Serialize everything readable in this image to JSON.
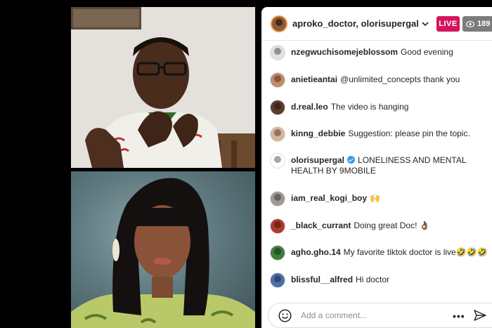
{
  "header": {
    "hosts": "aproko_doctor, olorisupergal",
    "live_label": "LIVE",
    "viewer_count": "189"
  },
  "comments": [
    {
      "user": "nzegwuchisomejeblossom",
      "text": "Good evening",
      "avatar_color": "#e0e0e0"
    },
    {
      "user": "anietieantai",
      "text": "@unlimited_concepts thank you",
      "avatar_color": "#c48a6a"
    },
    {
      "user": "d.real.leo",
      "text": "The video is hanging",
      "avatar_color": "#5a3d2e"
    },
    {
      "user": "kinng_debbie",
      "text": "Suggestion: please pin the topic.",
      "avatar_color": "#d9b49a"
    },
    {
      "user": "olorisupergal",
      "text": "LONELINESS AND MENTAL HEALTH BY 9MOBILE",
      "avatar_color": "#ffffff",
      "verified": true
    },
    {
      "user": "iam_real_kogi_boy",
      "text": "🙌",
      "avatar_color": "#9e9a94"
    },
    {
      "user": "_black_currant",
      "text": "Doing great Doc! 👌🏾",
      "avatar_color": "#b03a2e"
    },
    {
      "user": "agho.gho.14",
      "text": "My favorite tiktok doctor is live🤣🤣🤣",
      "avatar_color": "#3e7d3a"
    },
    {
      "user": "blissful__alfred",
      "text": "Hi doctor",
      "avatar_color": "#4b6fa8"
    }
  ],
  "composer": {
    "placeholder": "Add a comment...",
    "more": "•••"
  },
  "colors": {
    "live": "#d6135e",
    "viewer_badge": "#7c7c7c",
    "verified": "#3897f0"
  }
}
